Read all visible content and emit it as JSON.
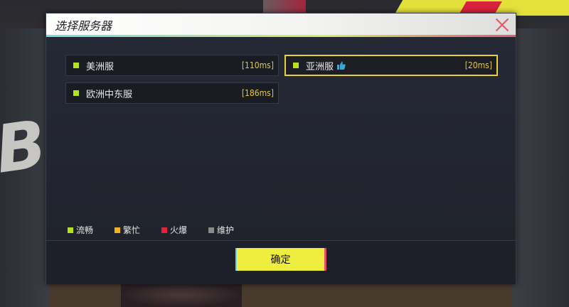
{
  "dialog": {
    "title": "选择服务器",
    "confirm_label": "确定"
  },
  "servers": [
    {
      "name": "美洲服",
      "ping": "[110ms]",
      "status_color": "#b5e21b",
      "selected": false,
      "recommended": false
    },
    {
      "name": "亚洲服",
      "ping": "[20ms]",
      "status_color": "#b5e21b",
      "selected": true,
      "recommended": true,
      "recommend_icon": "thumbs-up-icon"
    },
    {
      "name": "欧洲中东服",
      "ping": "[186ms]",
      "status_color": "#b5e21b",
      "selected": false,
      "recommended": false
    }
  ],
  "legend": [
    {
      "label": "流畅",
      "color": "#b5e21b"
    },
    {
      "label": "繁忙",
      "color": "#f2b21c"
    },
    {
      "label": "火爆",
      "color": "#e8203a"
    },
    {
      "label": "维护",
      "color": "#8a8a8a"
    }
  ],
  "colors": {
    "accent_yellow": "#efee3e",
    "selected_border": "#e7d23a",
    "ping_text": "#e7c93a",
    "close_icon": "#e8556a"
  }
}
